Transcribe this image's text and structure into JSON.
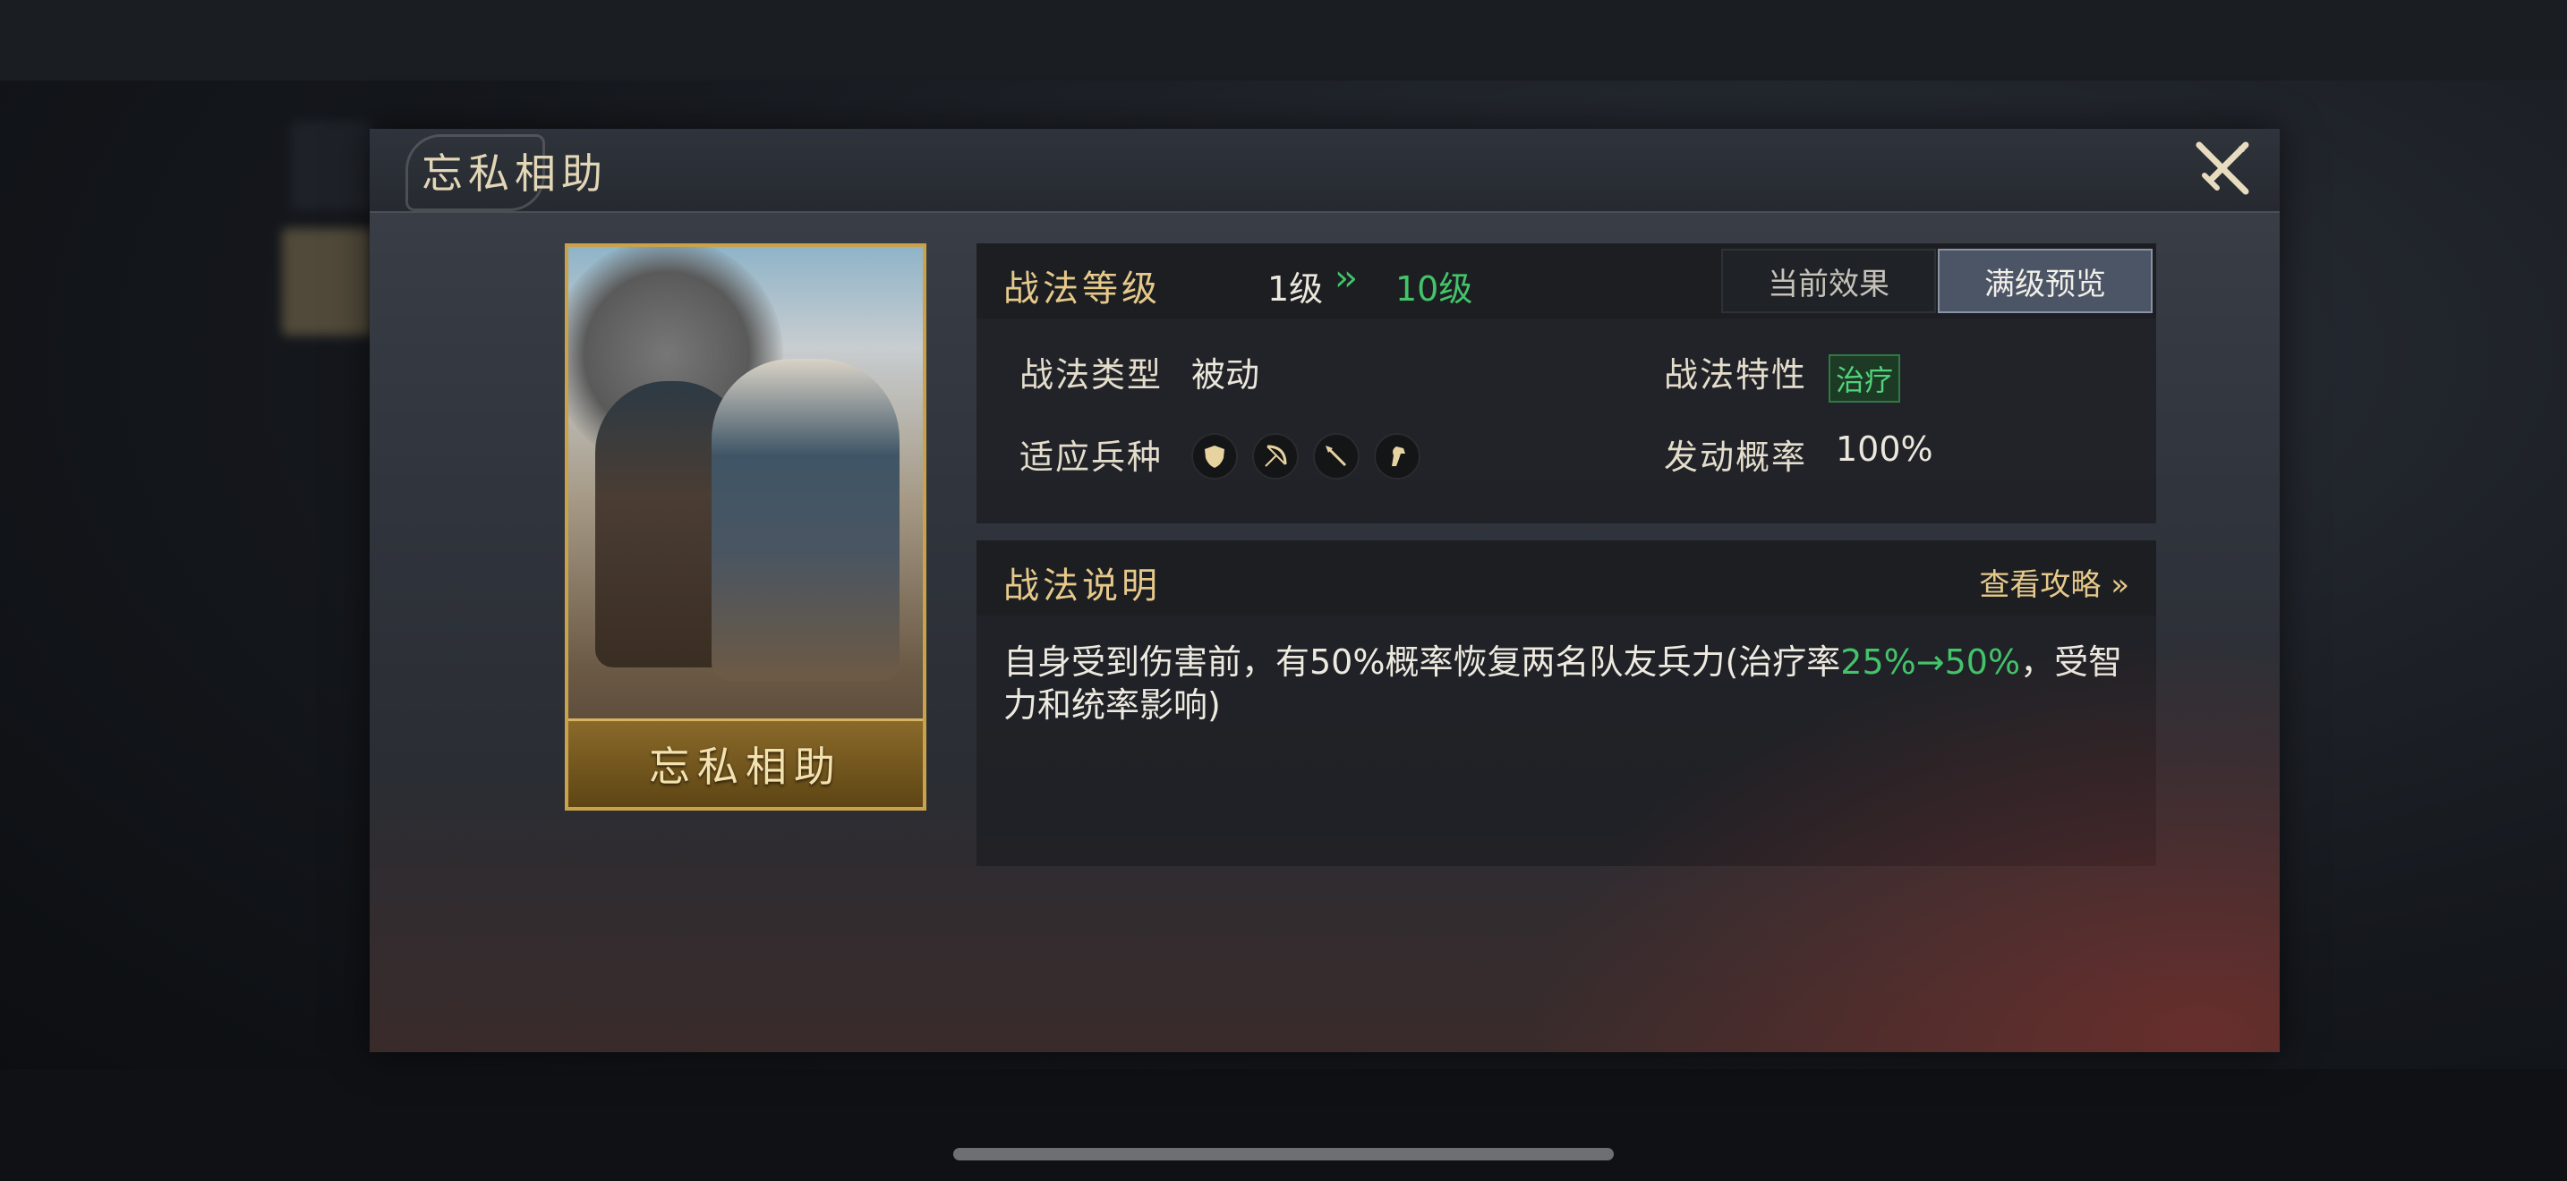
{
  "dialog": {
    "title": "忘私相助",
    "card_name": "忘私相助"
  },
  "level": {
    "label": "战法等级",
    "current": "1级",
    "arrow": "»",
    "max": "10级",
    "tabs": {
      "current_effect": "当前效果",
      "max_preview": "满级预览"
    },
    "selected_tab": "满级预览"
  },
  "attributes": {
    "type_label": "战法类型",
    "type_value": "被动",
    "trait_label": "战法特性",
    "trait_value": "治疗",
    "troops_label": "适应兵种",
    "troops": [
      "shield-unit-icon",
      "bow-unit-icon",
      "spear-unit-icon",
      "cavalry-unit-icon"
    ],
    "chance_label": "发动概率",
    "chance_value": "100%"
  },
  "description": {
    "title": "战法说明",
    "guide_link": "查看攻略 »",
    "text_part1": "自身受到伤害前，有50%概率恢复两名队友兵力(治疗率",
    "text_highlight": "25%→50%",
    "text_part2": "，受智力和统率影响)"
  },
  "colors": {
    "gold": "#e6c98a",
    "green": "#43c46a",
    "card_border": "#c9a24c"
  }
}
